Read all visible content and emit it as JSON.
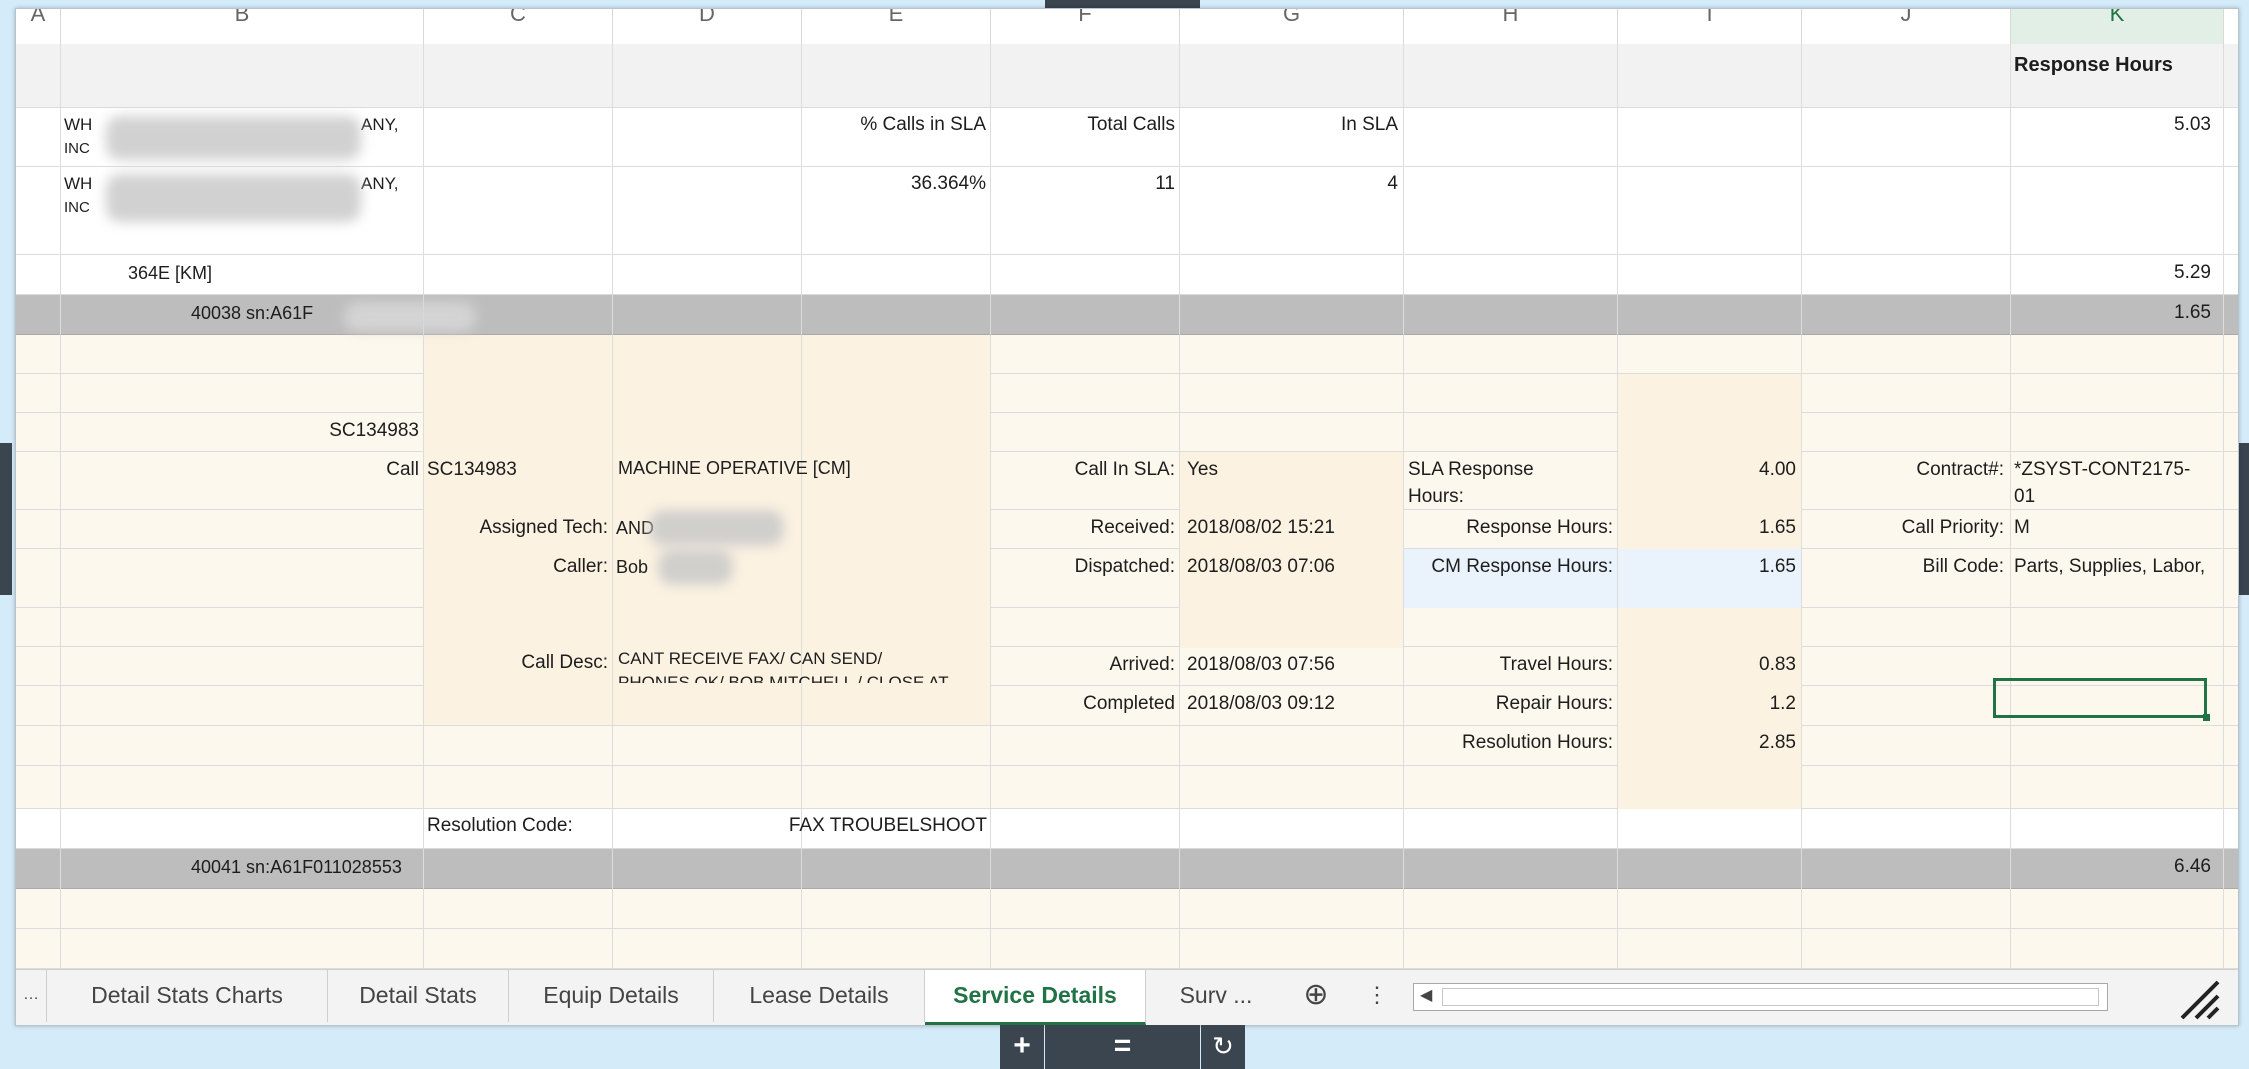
{
  "columns": [
    "A",
    "B",
    "C",
    "D",
    "E",
    "F",
    "G",
    "H",
    "I",
    "J",
    "K"
  ],
  "header": {
    "response_hours": "Response Hours"
  },
  "rows": {
    "r2": {
      "company": "WH",
      "company_end": "ANY,",
      "inc": "INC",
      "pct_label": "% Calls in SLA",
      "total_label": "Total Calls",
      "insla_label": "In SLA",
      "k": "5.03"
    },
    "r3": {
      "company": "WH",
      "company_end": "ANY,",
      "inc": "INC",
      "pct": "36.364%",
      "total": "11",
      "insla": "4"
    },
    "r4": {
      "label": "364E [KM]",
      "k": "5.29"
    },
    "r5": {
      "label": "40038  sn:A61F",
      "k": "1.65"
    },
    "sc_id": "SC134983",
    "detail": {
      "call_label": "Call",
      "call_value": "SC134983",
      "status": "MACHINE OPERATIVE [CM]",
      "tech_label": "Assigned Tech:",
      "tech_value": "AND",
      "caller_label": "Caller:",
      "caller_value": "Bob",
      "desc_label": "Call Desc:",
      "desc_line1": "CANT RECEIVE FAX/ CAN SEND/",
      "desc_line2": "PHONES OK/ BOB MITCHELL / CLOSE AT",
      "insla_label": "Call In SLA:",
      "insla_value": "Yes",
      "received_label": "Received:",
      "received_value": "2018/08/02 15:21",
      "dispatched_label": "Dispatched:",
      "dispatched_value": "2018/08/03 07:06",
      "arrived_label": "Arrived:",
      "arrived_value": "2018/08/03 07:56",
      "completed_label": "Completed",
      "completed_value": "2018/08/03 09:12",
      "sla_resp_label1": "SLA Response",
      "sla_resp_label2": "Hours:",
      "sla_resp_value": "4.00",
      "resp_label": "Response Hours:",
      "resp_value": "1.65",
      "cm_resp_label": "CM Response Hours:",
      "cm_resp_value": "1.65",
      "travel_label": "Travel Hours:",
      "travel_value": "0.83",
      "repair_label": "Repair Hours:",
      "repair_value": "1.2",
      "resolution_label": "Resolution Hours:",
      "resolution_value": "2.85",
      "contract_label": "Contract#:",
      "contract_value1": "*ZSYST-CONT2175-",
      "contract_value2": "01",
      "priority_label": "Call Priority:",
      "priority_value": "M",
      "bill_label": "Bill Code:",
      "bill_value": "Parts, Supplies, Labor,"
    },
    "res_code_label": "Resolution Code:",
    "res_code_value": "FAX TROUBELSHOOT",
    "r_next": {
      "label": "40041  sn:A61F011028553",
      "k": "6.46"
    }
  },
  "tabs": [
    "Detail Stats Charts",
    "Detail Stats",
    "Equip Details",
    "Lease Details",
    "Service Details",
    "Surv ..."
  ],
  "active_tab": "Service Details",
  "bottom_controls": {
    "add": "+",
    "menu": "=",
    "refresh": "↻"
  },
  "colors": {
    "accent": "#217346",
    "grey_row": "#bdbdbd",
    "cream": "#fdf8ee"
  }
}
